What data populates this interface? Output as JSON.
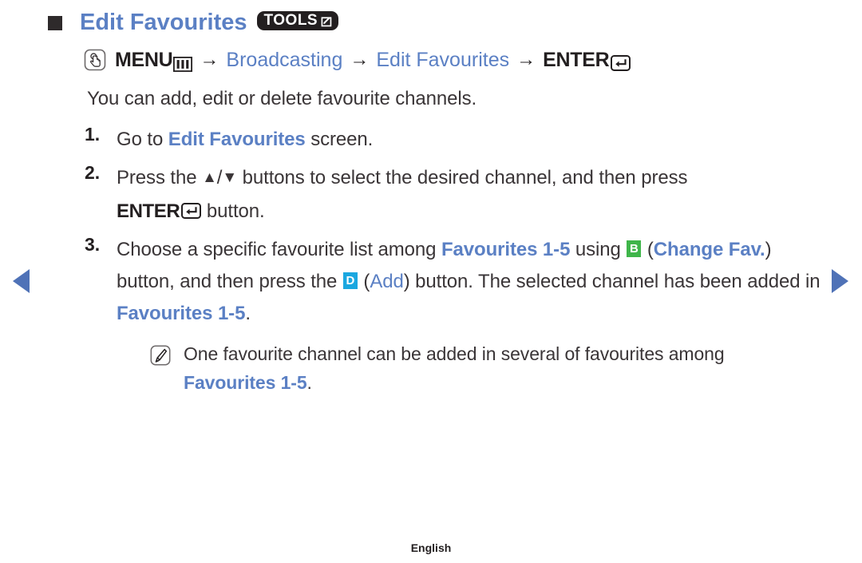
{
  "page": {
    "title": "Edit Favourites",
    "tools_badge": {
      "label": "TOOLS",
      "icon": "tools-arrow-icon"
    },
    "footer_language": "English"
  },
  "nav": {
    "prev_arrow_icon": "triangle-left-icon",
    "next_arrow_icon": "triangle-right-icon",
    "accent_color": "#4f72b7"
  },
  "menu_path": {
    "touch_icon": "hand-press-button-icon",
    "menu_label": "MENU",
    "menu_icon": "menu-bars-icon",
    "arrow1": "→",
    "item1": "Broadcasting",
    "arrow2": "→",
    "item2": "Edit Favourites",
    "arrow3": "→",
    "enter_label": "ENTER",
    "enter_icon": "enter-return-icon"
  },
  "intro": "You can add, edit or delete favourite channels.",
  "steps": [
    {
      "number": "1.",
      "parts": {
        "t1": "Go to ",
        "link": "Edit Favourites",
        "t2": " screen."
      }
    },
    {
      "number": "2.",
      "parts": {
        "t1": "Press the ",
        "up_arrow": "▲",
        "slash": "/",
        "down_arrow": "▼",
        "t2": " buttons to select the desired channel, and then press",
        "enter_label": "ENTER",
        "enter_icon": "enter-return-icon",
        "t3": " button."
      }
    },
    {
      "number": "3.",
      "parts": {
        "t1": "Choose a specific favourite list among ",
        "link1": "Favourites 1-5",
        "t2": " using ",
        "badge_b": "B",
        "badge_b_color": "#3fb54a",
        "t3": " (",
        "link2": "Change Fav.",
        "t4": ") button, and then press the ",
        "badge_d": "D",
        "badge_d_color": "#1aa7e0",
        "t5": " (",
        "link3": "Add",
        "t6": ") button. The selected channel has been added in ",
        "link4": "Favourites 1-5",
        "t7": "."
      }
    }
  ],
  "note": {
    "icon": "note-pencil-icon",
    "t1": "One favourite channel can be added in several of favourites among ",
    "link": "Favourites 1-5",
    "t2": "."
  },
  "colors": {
    "blue_link": "#5b80c4",
    "text": "#3a3537",
    "badge_dark": "#231f20"
  }
}
